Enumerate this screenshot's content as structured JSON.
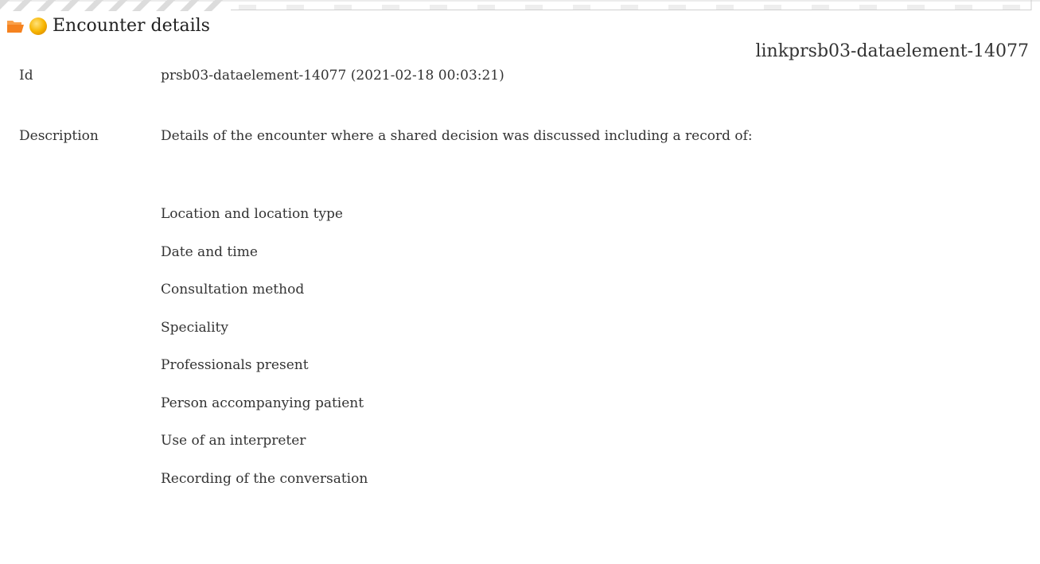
{
  "header": {
    "title": "Encounter details",
    "link_id": "linkprsb03-dataelement-14077"
  },
  "fields": {
    "id_label": "Id",
    "id_value": "prsb03-dataelement-14077 (2021-02-18 00:03:21)",
    "description_label": "Description",
    "description_value": "Details of the encounter where a shared decision was discussed including a record of:"
  },
  "description_items": [
    "Location and location type",
    "Date and time",
    "Consultation method",
    "Speciality",
    "Professionals present",
    "Person accompanying patient",
    "Use of an interpreter",
    "Recording of the conversation"
  ],
  "icons": {
    "folder": "open-folder-icon",
    "status": "status-dot-icon"
  },
  "colors": {
    "folder": "#f5821f",
    "status_dot": "#f7b500",
    "text": "#333333"
  }
}
